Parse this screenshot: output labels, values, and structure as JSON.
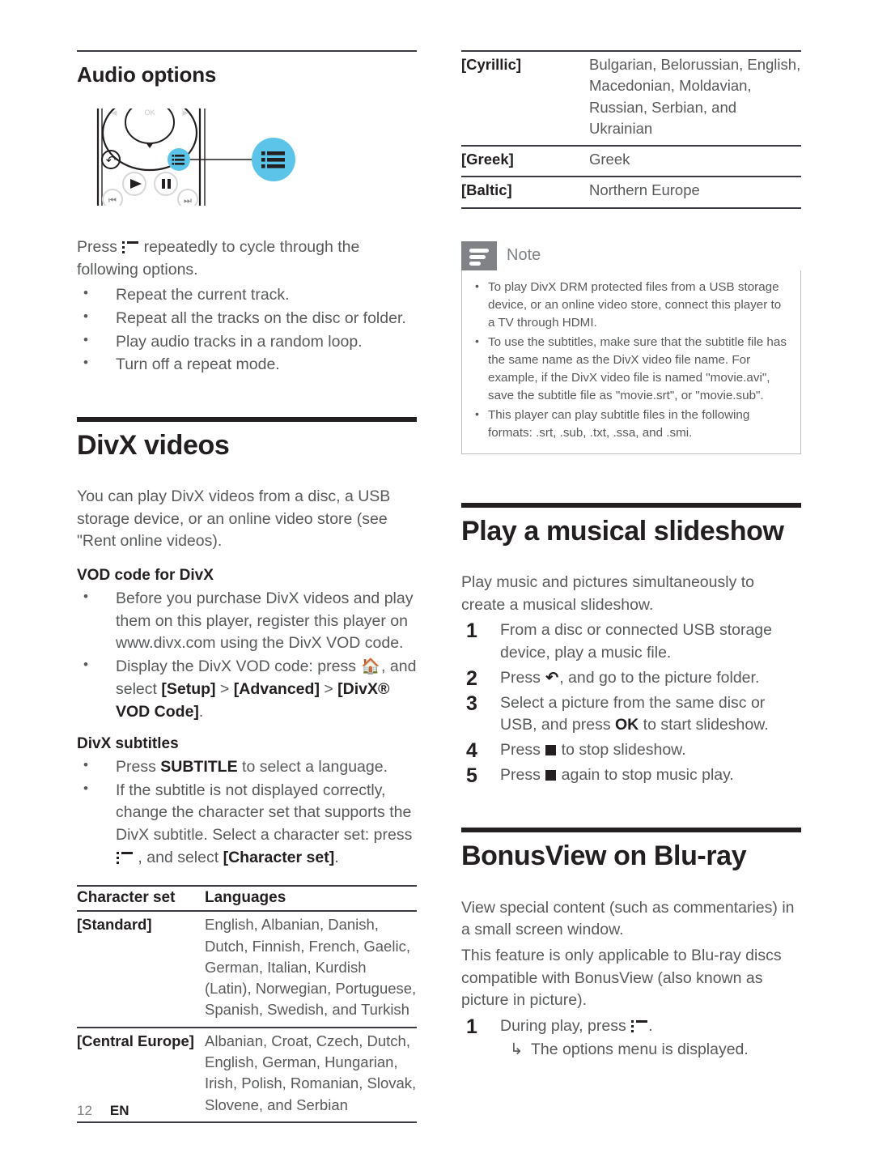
{
  "page": {
    "number": "12",
    "language": "EN",
    "accent_color": "#5cc4e8",
    "note_gray": "#808285",
    "text_color": "#58595b",
    "heading_color": "#231f20"
  },
  "left_column": {
    "audio_options": {
      "heading": "Audio options",
      "figure_name": "remote-control-options-button-callout",
      "intro": {
        "before": "Press ",
        "icon": "options-menu-icon",
        "after": " repeatedly to cycle through the following options."
      },
      "bullets": [
        "Repeat the current track.",
        "Repeat all the tracks on the disc or folder.",
        "Play audio tracks in a random loop.",
        "Turn off a repeat mode."
      ]
    },
    "divx_videos": {
      "heading": "DivX videos",
      "intro": "You can play DivX videos from a disc, a USB storage device, or an online video store (see \"Rent online videos).",
      "vod_code": {
        "heading": "VOD code for DivX",
        "bullets": [
          {
            "text": "Before you purchase DivX videos and play them on this player, register this player on www.divx.com using the DivX VOD code."
          },
          {
            "prefix": "Display the DivX VOD code: press ",
            "icon": "home-icon",
            "mid": ", and select ",
            "b1": "[Setup]",
            "sep1": " > ",
            "b2": "[Advanced]",
            "sep2": " > ",
            "b3": "[DivX® VOD Code]",
            "suffix": "."
          }
        ]
      },
      "subtitles": {
        "heading": "DivX subtitles",
        "bullets": [
          {
            "prefix": "Press ",
            "bold": "SUBTITLE",
            "suffix": " to select a language."
          },
          {
            "prefix": "If the subtitle is not displayed correctly, change the character set that supports the DivX subtitle. Select a character set: press ",
            "icon": "options-menu-icon",
            "mid": " , and select ",
            "bold": "[Character set]",
            "suffix": "."
          }
        ]
      }
    },
    "charset_table": {
      "headers": [
        "Character set",
        "Languages"
      ],
      "rows": [
        {
          "key": "[Standard]",
          "value": "English, Albanian, Danish, Dutch, Finnish, French, Gaelic, German, Italian, Kurdish (Latin), Norwegian, Portuguese, Spanish, Swedish, and Turkish"
        },
        {
          "key": "[Central Europe]",
          "value": "Albanian, Croat, Czech, Dutch, English, German, Hungarian, Irish, Polish, Romanian, Slovak, Slovene, and Serbian"
        }
      ]
    }
  },
  "right_column": {
    "charset_table_cont": {
      "rows": [
        {
          "key": "[Cyrillic]",
          "value": "Bulgarian, Belorussian, English, Macedonian, Moldavian, Russian, Serbian, and Ukrainian"
        },
        {
          "key": "[Greek]",
          "value": "Greek"
        },
        {
          "key": "[Baltic]",
          "value": "Northern Europe"
        }
      ]
    },
    "note": {
      "title": "Note",
      "icon": "note-lines-icon",
      "items": [
        "To play DivX DRM protected files from a USB storage device, or an online video store, connect this player to a TV through HDMI.",
        "To use the subtitles, make sure that the subtitle file has the same name as the DivX video file name. For example, if the DivX video file is named \"movie.avi\", save the subtitle file as \"movie.srt\", or \"movie.sub\".",
        "This player can play subtitle files in the following formats: .srt, .sub, .txt, .ssa, and .smi."
      ]
    },
    "musical_slideshow": {
      "heading": "Play a musical slideshow",
      "intro": "Play music and pictures simultaneously to create a musical slideshow.",
      "steps": [
        {
          "num": "1",
          "text": "From a disc or connected USB storage device, play a music file."
        },
        {
          "num": "2",
          "prefix": "Press ",
          "icon": "back-arrow-icon",
          "suffix": ", and go to the picture folder."
        },
        {
          "num": "3",
          "prefix": "Select a picture from the same disc or USB, and press ",
          "bold": "OK",
          "suffix": " to start slideshow."
        },
        {
          "num": "4",
          "prefix": "Press ",
          "icon": "stop-icon",
          "suffix": " to stop slideshow."
        },
        {
          "num": "5",
          "prefix": "Press ",
          "icon": "stop-icon",
          "suffix": " again to stop music play."
        }
      ]
    },
    "bonusview": {
      "heading": "BonusView on Blu-ray",
      "para1": "View special content (such as commentaries) in a small screen window.",
      "para2": "This feature is only applicable to Blu-ray discs compatible with BonusView (also known as picture in picture).",
      "steps": [
        {
          "num": "1",
          "prefix": "During play, press ",
          "icon": "options-menu-icon",
          "suffix": ".",
          "result_arrow": "↳",
          "result": "The options menu is displayed."
        }
      ]
    }
  }
}
